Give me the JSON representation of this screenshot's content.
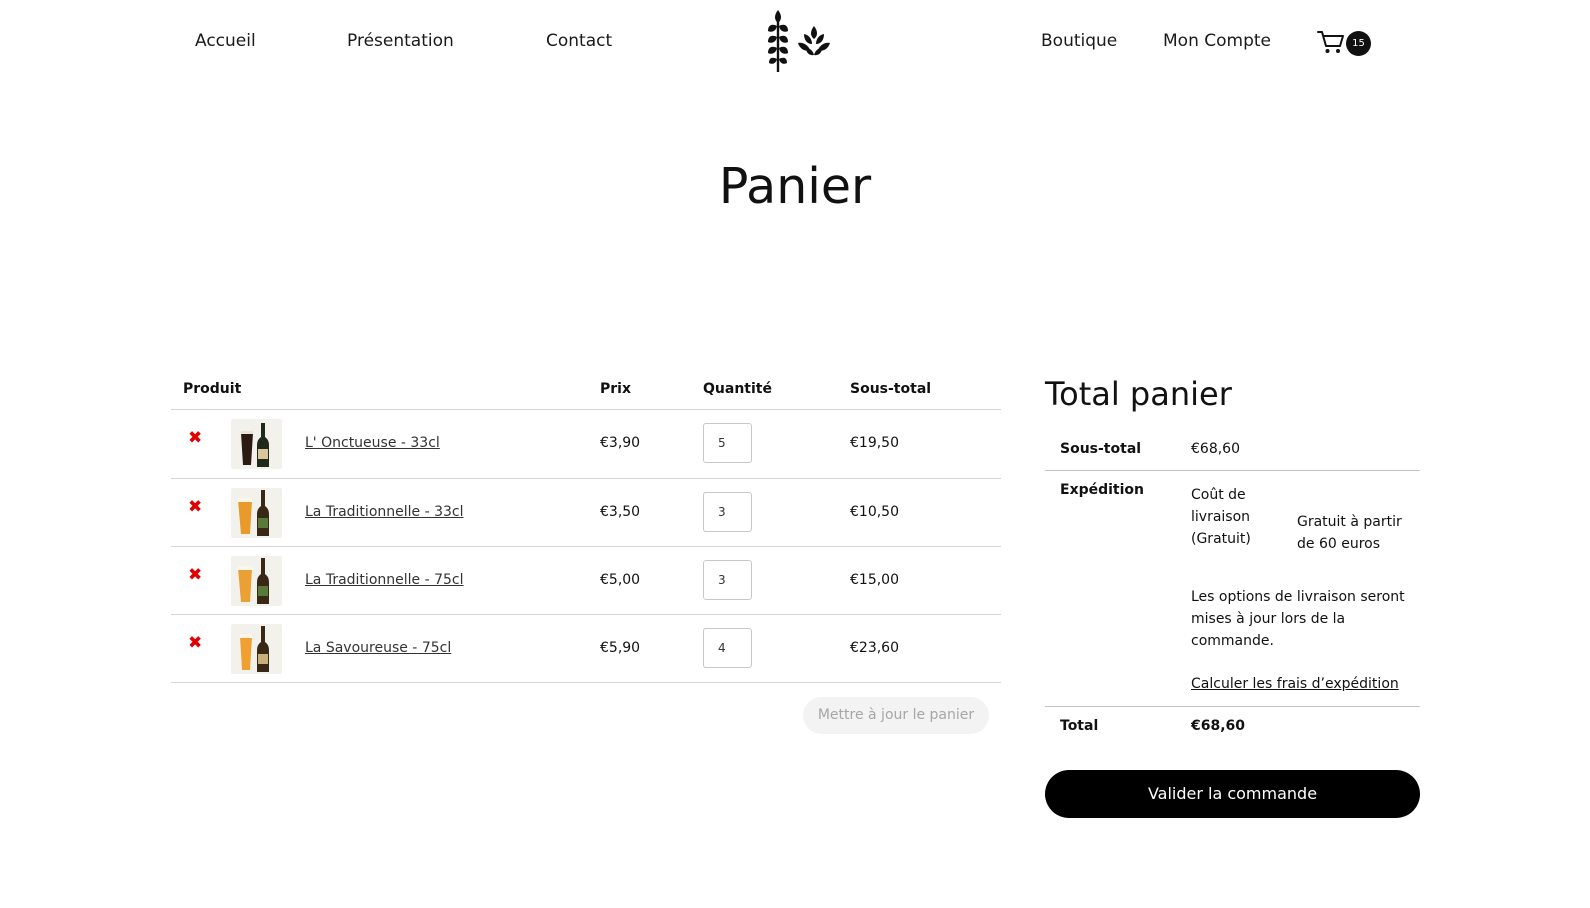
{
  "nav": {
    "left": [
      "Accueil",
      "Présentation",
      "Contact"
    ],
    "right": [
      "Boutique",
      "Mon Compte"
    ],
    "cart_count": "15",
    "logo_icon": "wheat-hop-logo",
    "cart_icon": "shopping-cart-icon"
  },
  "page_title": "Panier",
  "cart": {
    "headers": {
      "product": "Produit",
      "price": "Prix",
      "quantity": "Quantité",
      "subtotal": "Sous-total"
    },
    "remove_symbol": "✖",
    "items": [
      {
        "name": "L' Onctueuse - 33cl",
        "price": "€3,90",
        "quantity": "5",
        "subtotal": "€19,50",
        "glass": "dark"
      },
      {
        "name": "La Traditionnelle - 33cl",
        "price": "€3,50",
        "quantity": "3",
        "subtotal": "€10,50",
        "glass": "amber"
      },
      {
        "name": "La Traditionnelle - 75cl",
        "price": "€5,00",
        "quantity": "3",
        "subtotal": "€15,00",
        "glass": "amber"
      },
      {
        "name": "La Savoureuse - 75cl",
        "price": "€5,90",
        "quantity": "4",
        "subtotal": "€23,60",
        "glass": "amber"
      }
    ],
    "update_button": "Mettre à jour le panier"
  },
  "totals": {
    "title": "Total panier",
    "subtotal_label": "Sous-total",
    "subtotal_value": "€68,60",
    "shipping_label": "Expédition",
    "shipping_method": "Coût de livraison (Gratuit)",
    "shipping_note": "Gratuit à partir de 60 euros",
    "shipping_info": "Les options de livraison seront mises à jour lors de la commande.",
    "calc_link": "Calculer les frais d’expédition",
    "total_label": "Total",
    "total_value": "€68,60",
    "checkout_button": "Valider la commande"
  },
  "colors": {
    "remove": "#e00000",
    "primary_button": "#000000",
    "disabled_button": "#f3f3f3"
  }
}
